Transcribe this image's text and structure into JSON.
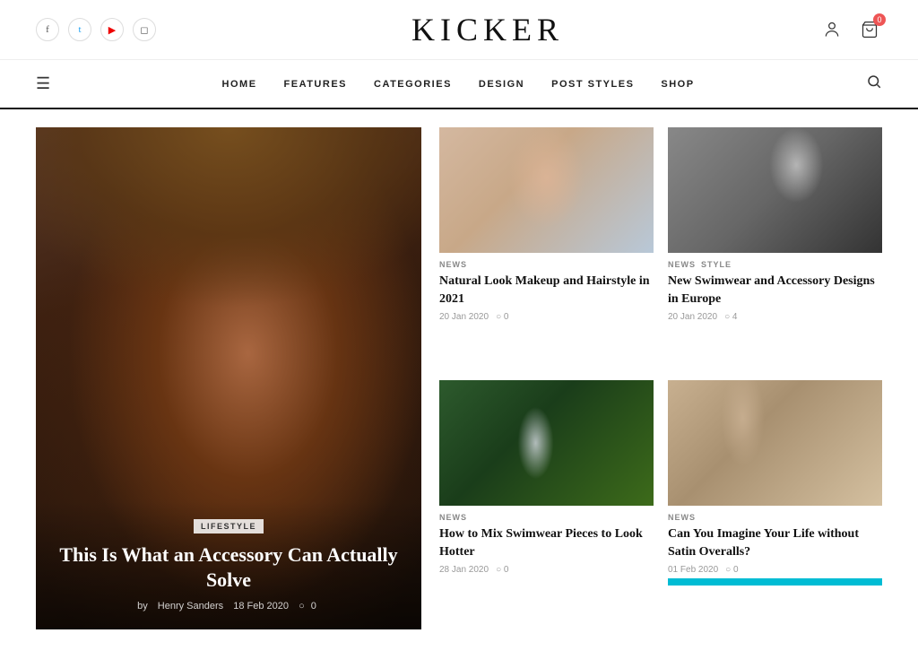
{
  "site": {
    "name": "KICKER"
  },
  "social": [
    {
      "id": "facebook",
      "label": "f",
      "class": "facebook"
    },
    {
      "id": "twitter",
      "label": "t",
      "class": "twitter"
    },
    {
      "id": "youtube",
      "label": "▶",
      "class": "youtube"
    },
    {
      "id": "instagram",
      "label": "◻",
      "class": "instagram"
    }
  ],
  "nav": {
    "links": [
      {
        "id": "home",
        "label": "HOME"
      },
      {
        "id": "features",
        "label": "FEATURES"
      },
      {
        "id": "categories",
        "label": "CATEGORIES"
      },
      {
        "id": "design",
        "label": "DESIGN"
      },
      {
        "id": "post-styles",
        "label": "POST STYLES"
      },
      {
        "id": "shop",
        "label": "SHOP"
      }
    ]
  },
  "featured": {
    "category": "LIFESTYLE",
    "title": "This Is What an Accessory Can Actually Solve",
    "author": "Henry Sanders",
    "date": "18 Feb 2020",
    "comments": "0"
  },
  "articles": [
    {
      "id": "makeup",
      "tags": [
        "NEWS"
      ],
      "title": "Natural Look Makeup and Hairstyle in 2021",
      "date": "20 Jan 2020",
      "comments": "0",
      "img_class": "img-makeup"
    },
    {
      "id": "swimwear-bw",
      "tags": [
        "NEWS",
        "STYLE"
      ],
      "title": "New Swimwear and Accessory Designs in Europe",
      "date": "20 Jan 2020",
      "comments": "4",
      "img_class": "img-swimwear-bw"
    },
    {
      "id": "tropical",
      "tags": [
        "NEWS"
      ],
      "title": "How to Mix Swimwear Pieces to Look Hotter",
      "date": "28 Jan 2020",
      "comments": "0",
      "img_class": "img-tropical"
    },
    {
      "id": "satin",
      "tags": [
        "NEWS"
      ],
      "title": "Can You Imagine Your Life without Satin Overalls?",
      "date": "01 Feb 2020",
      "comments": "0",
      "img_class": "img-satin"
    }
  ],
  "cart_count": "0",
  "labels": {
    "by": "by",
    "comment_icon": "○"
  }
}
